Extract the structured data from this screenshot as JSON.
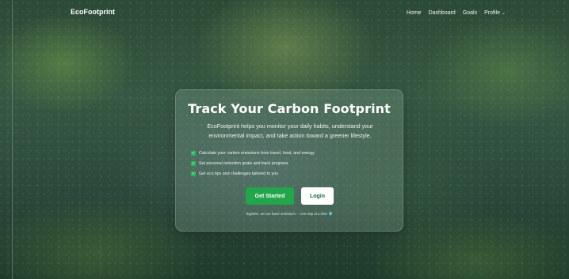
{
  "brand": {
    "name": "EcoFootprint"
  },
  "nav": {
    "items": [
      "Home",
      "Dashboard",
      "Goals",
      "Profile"
    ],
    "profile_caret": "⌄"
  },
  "hero": {
    "title": "Track Your Carbon Footprint",
    "intro": "EcoFootprint helps you monitor your daily habits, understand your environmental impact, and take action toward a greener lifestyle.",
    "features": [
      "Calculate your carbon emissions from travel, food, and energy",
      "Set personal reduction goals and track progress",
      "Get eco tips and challenges tailored to you"
    ],
    "buttons": {
      "primary": "Get Started",
      "secondary": "Login"
    },
    "tagline": "Together, we can lower emissions — one step at a time.",
    "tagline_icon": "🌍"
  },
  "colors": {
    "accent": "#23a54b",
    "check": "#2fb45a"
  }
}
